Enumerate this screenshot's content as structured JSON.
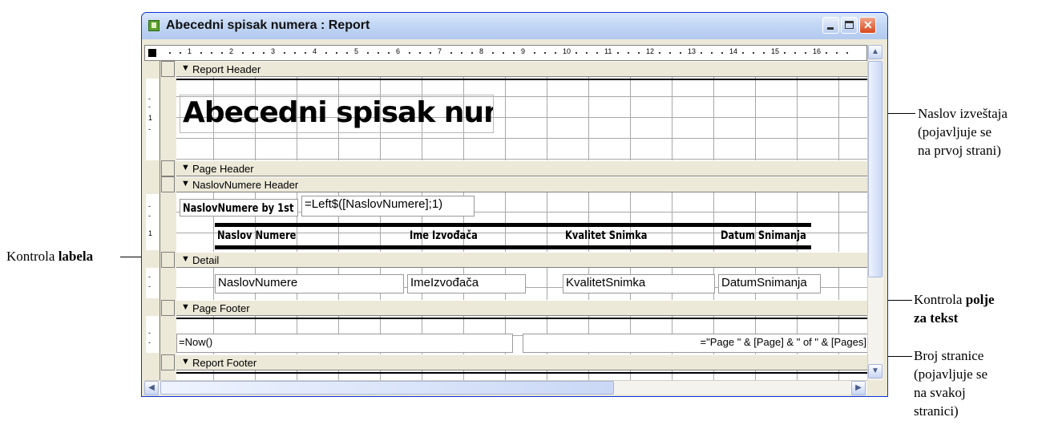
{
  "window": {
    "title": "Abecedni spisak numera : Report"
  },
  "ruler": {
    "labels": [
      "1",
      "2",
      "3",
      "4",
      "5",
      "6",
      "7",
      "8",
      "9",
      "10",
      "11",
      "12",
      "13",
      "14",
      "15",
      "16"
    ]
  },
  "vruler": {
    "mark_1": "1"
  },
  "sections": {
    "report_header": "Report Header",
    "page_header": "Page Header",
    "group_header": "NaslovNumere Header",
    "detail": "Detail",
    "page_footer": "Page Footer",
    "report_footer": "Report Footer"
  },
  "controls": {
    "report_title": "Abecedni spisak numera",
    "group_label": "NaslovNumere by 1st",
    "group_expr": "=Left$([NaslovNumere];1)",
    "col_labels": [
      "Naslov Numere",
      "Ime Izvođača",
      "Kvalitet Snimka",
      "Datum Snimanja"
    ],
    "detail_fields": [
      "NaslovNumere",
      "ImeIzvođača",
      "KvalitetSnimka",
      "DatumSnimanja"
    ],
    "footer_now": "=Now()",
    "footer_page": "=\"Page \" & [Page] & \" of \" & [Pages]"
  },
  "annotations": {
    "naslov_line1": "Naslov izveštaja",
    "naslov_line2": "(pojavljuje se",
    "naslov_line3": "na prvoj strani)",
    "labela_prefix": "Kontrola ",
    "labela_bold": "labela",
    "polje_prefix": "Kontrola ",
    "polje_bold1": "polje",
    "polje_bold2": "za tekst",
    "broj_line1": "Broj stranice",
    "broj_line2": "(pojavljuje se",
    "broj_line3": "na svakoj",
    "broj_line4": "stranici)"
  },
  "icons": {
    "app": "access-report-icon",
    "section": "section-arrow-icon"
  }
}
